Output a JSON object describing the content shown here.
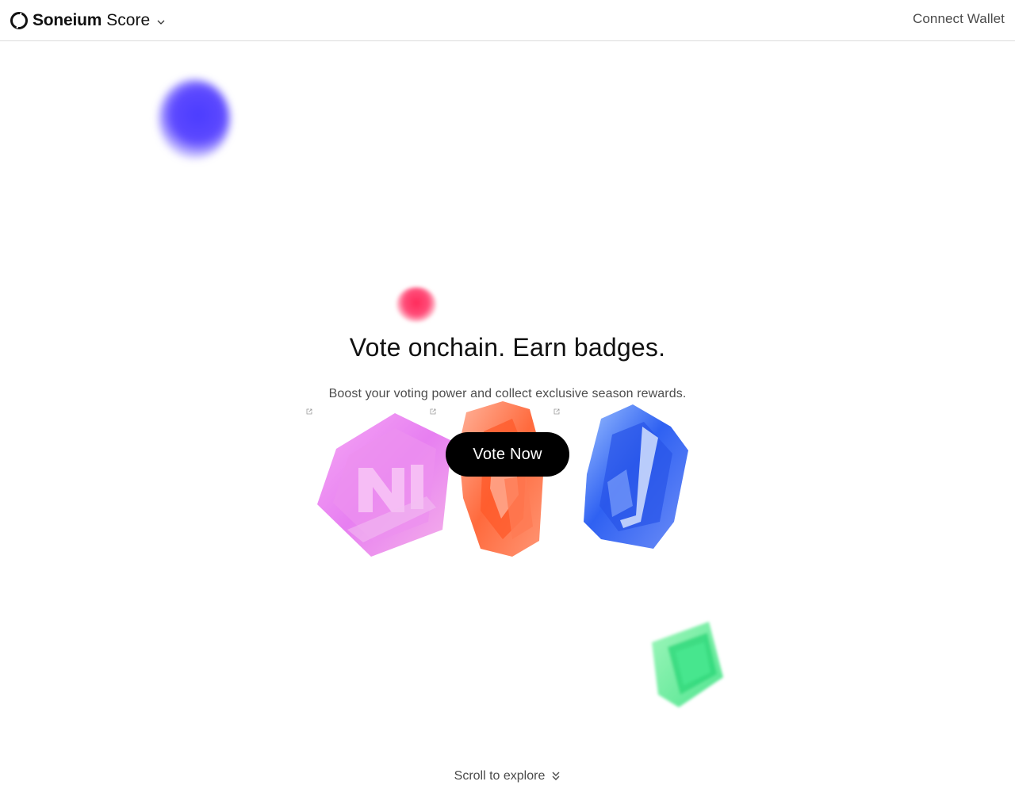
{
  "header": {
    "brand_name": "Soneium",
    "product_name": "Score",
    "connect_label": "Connect Wallet"
  },
  "hero": {
    "title": "Vote onchain. Earn badges.",
    "subtitle": "Boost your voting power and collect exclusive season rewards.",
    "cta_label": "Vote Now"
  },
  "footer": {
    "scroll_label": "Scroll to explore"
  },
  "icons": {
    "logo": "soneium-logo-icon",
    "brand_menu": "chevron-down-icon",
    "external": "external-link-icon",
    "scroll": "double-chevron-down-icon"
  },
  "colors": {
    "cta_background": "#000000",
    "purple_blob": "#5a46ff",
    "heart_blob": "#ff3d6a",
    "green_blob": "#3de27e",
    "pink_badge": "#e97cf2",
    "orange_badge": "#ff6a3d",
    "blue_badge": "#2f61f2"
  }
}
